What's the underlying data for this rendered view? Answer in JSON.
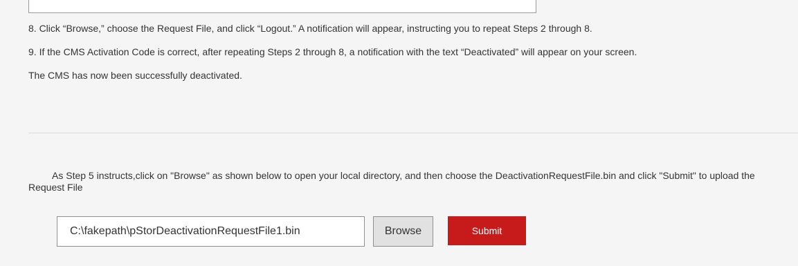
{
  "steps": {
    "step8": "8. Click “Browse,” choose the Request File, and click “Logout.” A notification will appear, instructing you to repeat Steps 2 through 8.",
    "step9": "9. If the CMS Activation Code is correct, after repeating Steps 2 through 8, a notification with the text “Deactivated” will appear on your screen.",
    "conclusion": "The CMS has now been successfully deactivated."
  },
  "instruction": "As Step 5 instructs,click on \"Browse\" as shown below to open your local directory, and then choose the DeactivationRequestFile.bin and click \"Submit\" to upload the Request File",
  "upload": {
    "file_path": "C:\\fakepath\\pStorDeactivationRequestFile1.bin",
    "browse_label": "Browse",
    "submit_label": "Submit"
  },
  "colors": {
    "background": "#f5f5f5",
    "text": "#333333",
    "submit": "#c71a1a"
  }
}
